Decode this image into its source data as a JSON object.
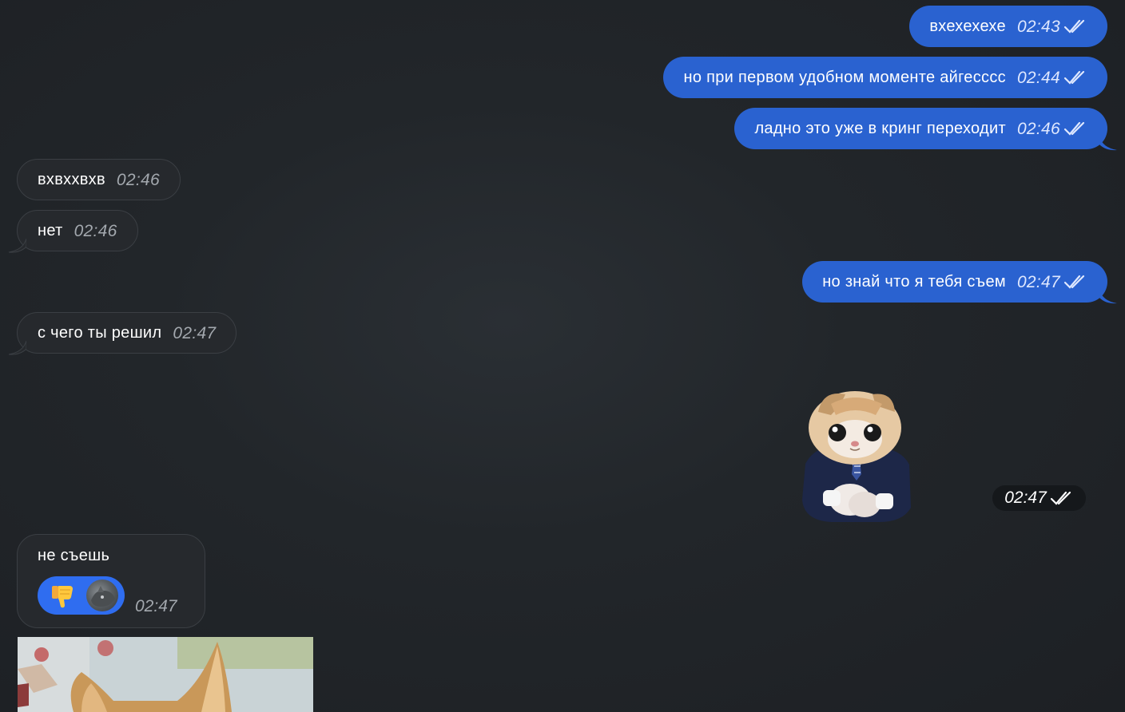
{
  "messages": [
    {
      "id": "m1",
      "direction": "outgoing",
      "text": "вхехехехе",
      "time": "02:43",
      "status": "read"
    },
    {
      "id": "m2",
      "direction": "outgoing",
      "text": "но при первом удобном моменте айгесссс",
      "time": "02:44",
      "status": "read"
    },
    {
      "id": "m3",
      "direction": "outgoing",
      "text": "ладно это уже в кринг переходит",
      "time": "02:46",
      "status": "read"
    },
    {
      "id": "m4",
      "direction": "incoming",
      "text": "вхвххвхв",
      "time": "02:46"
    },
    {
      "id": "m5",
      "direction": "incoming",
      "text": "нет",
      "time": "02:46"
    },
    {
      "id": "m6",
      "direction": "outgoing",
      "text": "но знай что я тебя съем",
      "time": "02:47",
      "status": "read"
    },
    {
      "id": "m7",
      "direction": "incoming",
      "text": "с чего ты решил",
      "time": "02:47"
    },
    {
      "id": "m8",
      "direction": "outgoing",
      "type": "sticker",
      "sticker_icon": "cat-in-suit-sticker",
      "time": "02:47",
      "status": "read"
    },
    {
      "id": "m9",
      "direction": "incoming",
      "text": "не съешь",
      "time": "02:47",
      "reaction": {
        "emoji": "👎",
        "icon": "thumbs-down-icon"
      }
    },
    {
      "id": "m10",
      "direction": "incoming",
      "type": "photo",
      "photo_icon": "cat-photo"
    }
  ],
  "colors": {
    "background": "#1f2327",
    "outgoing_bubble": "#2a62d0",
    "incoming_bubble": "#26292d",
    "reaction_pill": "#2f6df0",
    "incoming_time": "#a3a8ae"
  },
  "icons": {
    "read_status": "double-check-icon"
  }
}
